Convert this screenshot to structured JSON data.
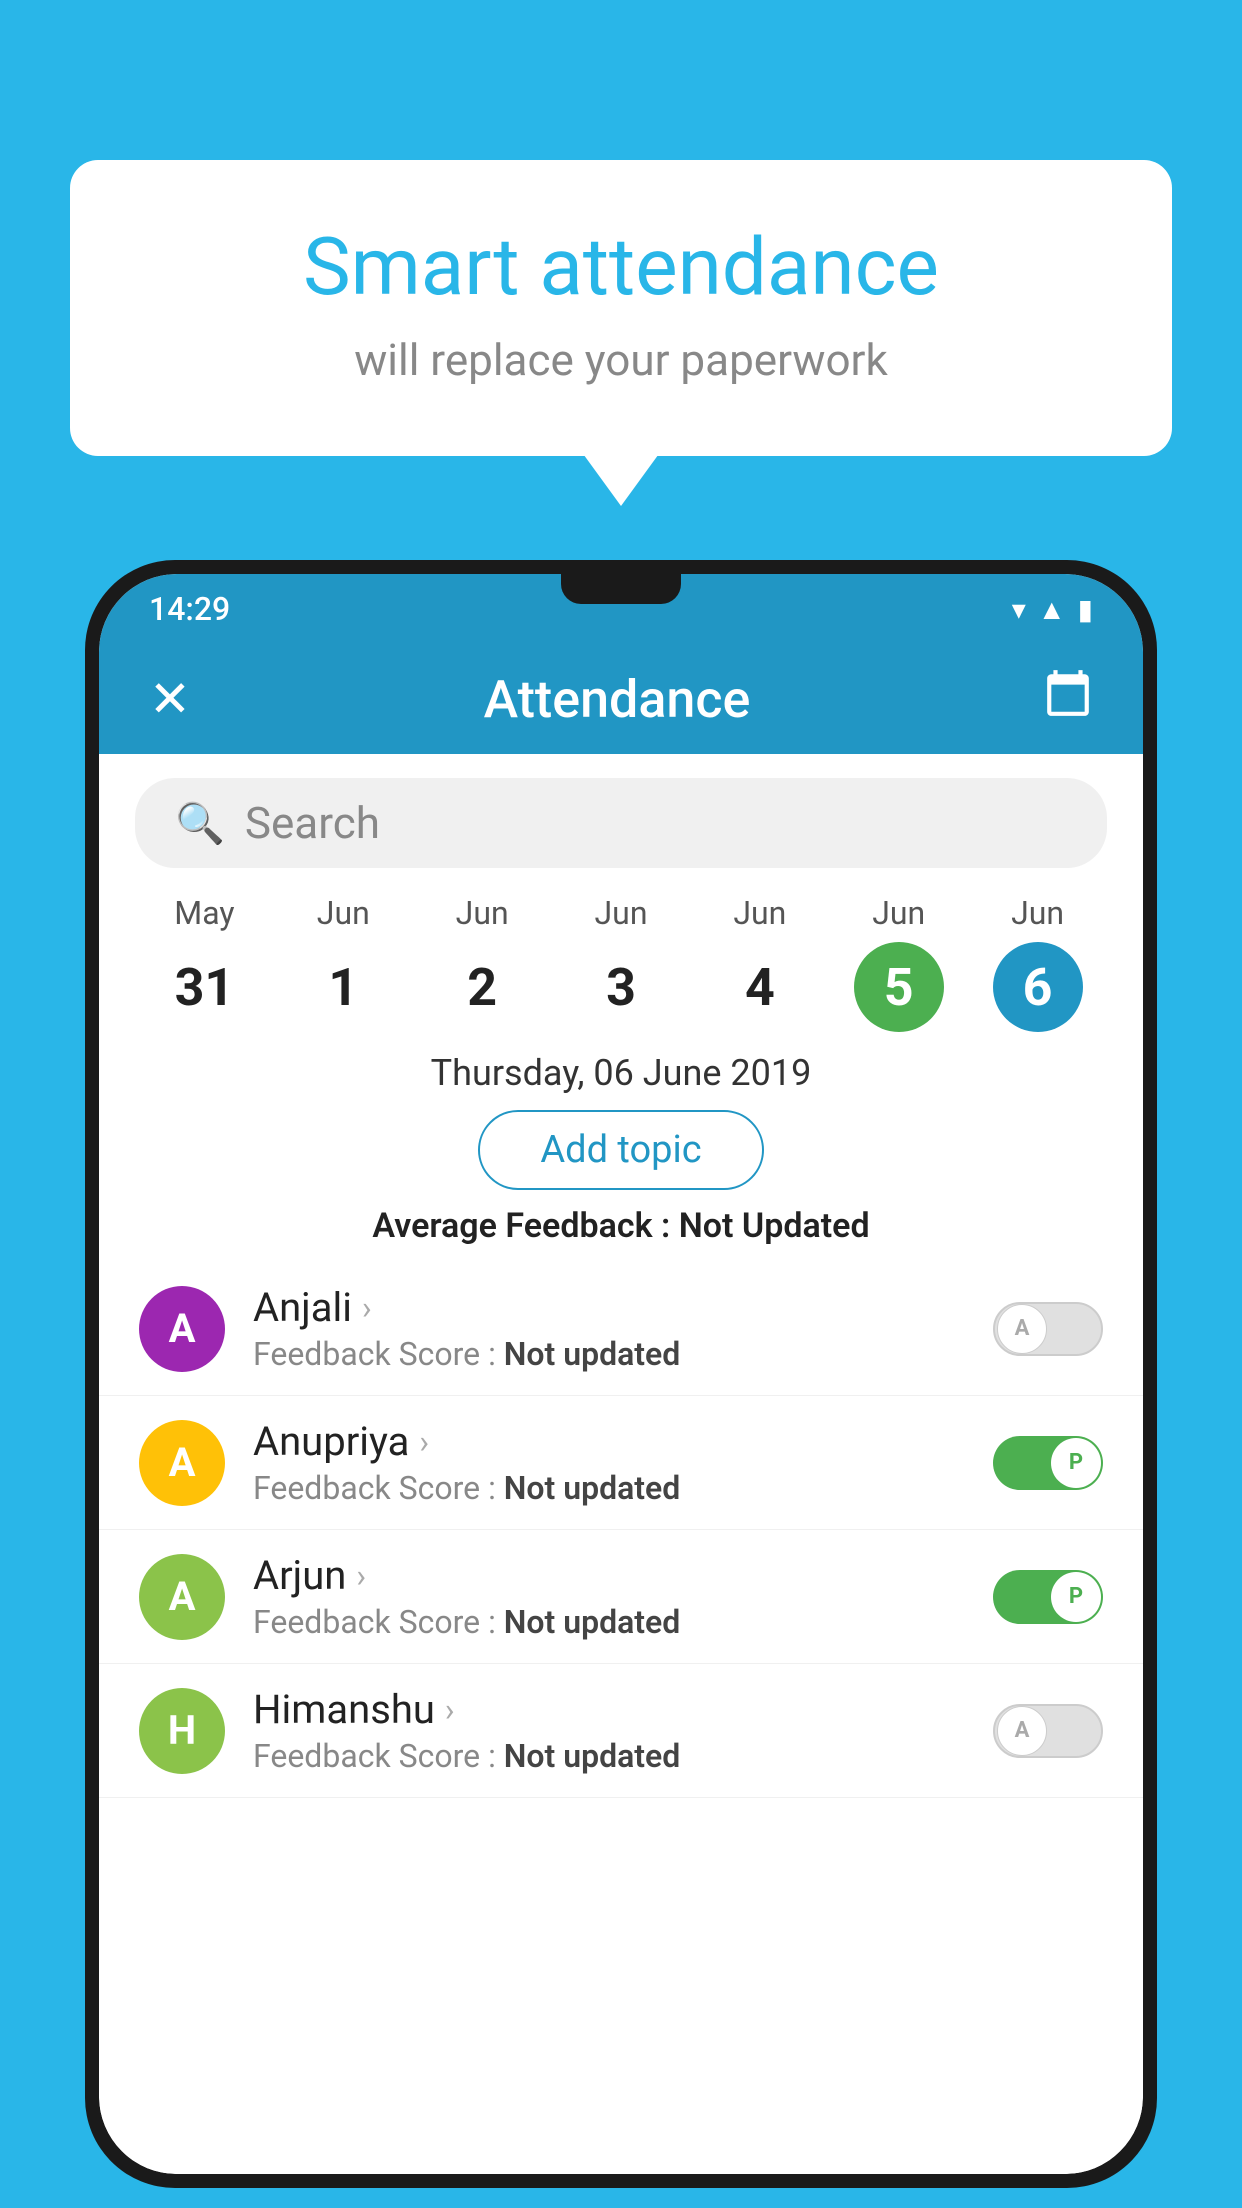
{
  "background_color": "#29b6e8",
  "bubble": {
    "title": "Smart attendance",
    "subtitle": "will replace your paperwork"
  },
  "status_bar": {
    "time": "14:29"
  },
  "app_bar": {
    "title": "Attendance",
    "close_icon": "✕",
    "calendar_icon": "📅"
  },
  "search": {
    "placeholder": "Search"
  },
  "dates": [
    {
      "month": "May",
      "day": "31",
      "state": "normal"
    },
    {
      "month": "Jun",
      "day": "1",
      "state": "normal"
    },
    {
      "month": "Jun",
      "day": "2",
      "state": "normal"
    },
    {
      "month": "Jun",
      "day": "3",
      "state": "normal"
    },
    {
      "month": "Jun",
      "day": "4",
      "state": "normal"
    },
    {
      "month": "Jun",
      "day": "5",
      "state": "today"
    },
    {
      "month": "Jun",
      "day": "6",
      "state": "selected"
    }
  ],
  "selected_date": "Thursday, 06 June 2019",
  "add_topic_label": "Add topic",
  "average_feedback": {
    "label": "Average Feedback : ",
    "value": "Not Updated"
  },
  "students": [
    {
      "name": "Anjali",
      "avatar_letter": "A",
      "avatar_color": "#9c27b0",
      "feedback": "Feedback Score : ",
      "feedback_value": "Not updated",
      "toggle_state": "off",
      "toggle_label": "A"
    },
    {
      "name": "Anupriya",
      "avatar_letter": "A",
      "avatar_color": "#ffc107",
      "feedback": "Feedback Score : ",
      "feedback_value": "Not updated",
      "toggle_state": "on",
      "toggle_label": "P"
    },
    {
      "name": "Arjun",
      "avatar_letter": "A",
      "avatar_color": "#8bc34a",
      "feedback": "Feedback Score : ",
      "feedback_value": "Not updated",
      "toggle_state": "on",
      "toggle_label": "P"
    },
    {
      "name": "Himanshu",
      "avatar_letter": "H",
      "avatar_color": "#8bc34a",
      "feedback": "Feedback Score : ",
      "feedback_value": "Not updated",
      "toggle_state": "off",
      "toggle_label": "A"
    }
  ]
}
